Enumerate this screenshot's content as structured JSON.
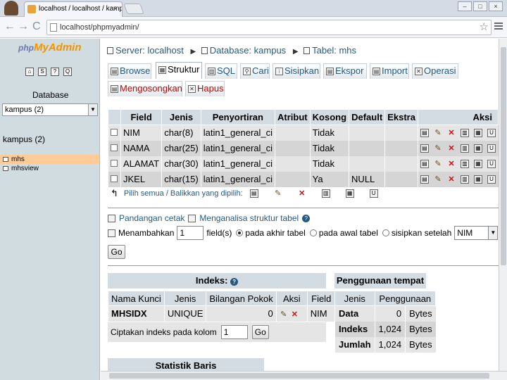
{
  "browser": {
    "tab_title": "localhost / localhost / kampus",
    "tab_close": "×",
    "url": "localhost/phpmyadmin/",
    "back": "←",
    "forward": "→",
    "reload": "C",
    "star": "☆",
    "win_min": "–",
    "win_max": "□",
    "win_close": "×"
  },
  "left": {
    "logo_php": "php",
    "logo_ma": "MyAdmin",
    "database_label": "Database",
    "db_select_value": "kampus (2)",
    "db_name": "kampus (2)",
    "tables": [
      "mhs",
      "mhsview"
    ]
  },
  "breadcrumb": {
    "server": "Server: localhost",
    "database": "Database: kampus",
    "table": "Tabel: mhs"
  },
  "tabs": [
    {
      "label": "Browse",
      "icon": "browse-icon"
    },
    {
      "label": "Struktur",
      "icon": "structure-icon"
    },
    {
      "label": "SQL",
      "icon": "sql-icon"
    },
    {
      "label": "Cari",
      "icon": "search-icon"
    },
    {
      "label": "Sisipkan",
      "icon": "insert-icon"
    },
    {
      "label": "Ekspor",
      "icon": "export-icon"
    },
    {
      "label": "Import",
      "icon": "import-icon"
    },
    {
      "label": "Operasi",
      "icon": "operations-icon"
    },
    {
      "label": "Mengosongkan",
      "icon": "empty-icon"
    },
    {
      "label": "Hapus",
      "icon": "drop-icon"
    }
  ],
  "structure": {
    "headers": [
      "Field",
      "Jenis",
      "Penyortiran",
      "Atribut",
      "Kosong",
      "Default",
      "Ekstra",
      "Aksi"
    ],
    "rows": [
      {
        "field": "NIM",
        "jenis": "char(8)",
        "collation": "latin1_general_ci",
        "atribut": "",
        "kosong": "Tidak",
        "default": "",
        "ekstra": ""
      },
      {
        "field": "NAMA",
        "jenis": "char(25)",
        "collation": "latin1_general_ci",
        "atribut": "",
        "kosong": "Tidak",
        "default": "",
        "ekstra": ""
      },
      {
        "field": "ALAMAT",
        "jenis": "char(30)",
        "collation": "latin1_general_ci",
        "atribut": "",
        "kosong": "Tidak",
        "default": "",
        "ekstra": ""
      },
      {
        "field": "JKEL",
        "jenis": "char(15)",
        "collation": "latin1_general_ci",
        "atribut": "",
        "kosong": "Ya",
        "default": "NULL",
        "ekstra": ""
      }
    ],
    "select_all": "Pilih semua / Balikkan yang dipilih:"
  },
  "links": {
    "print_view": "Pandangan cetak",
    "analyze": "Menganalisa struktur tabel"
  },
  "add_fields": {
    "label": "Menambahkan",
    "count": "1",
    "fields_label": "field(s)",
    "opt_end": "pada akhir tabel",
    "opt_begin": "pada awal tabel",
    "opt_after": "sisipkan setelah",
    "after_select": "NIM",
    "go": "Go"
  },
  "indexes": {
    "title": "Indeks:",
    "headers": [
      "Nama Kunci",
      "Jenis",
      "Bilangan Pokok",
      "Aksi",
      "Field"
    ],
    "row": {
      "name": "MHSIDX",
      "type": "UNIQUE",
      "cardinality": "0",
      "field": "NIM"
    },
    "create_label": "Ciptakan indeks pada kolom",
    "create_count": "1",
    "go": "Go"
  },
  "usage": {
    "title": "Penggunaan tempat",
    "headers": [
      "Jenis",
      "Penggunaan"
    ],
    "rows": [
      {
        "type": "Data",
        "value": "0",
        "unit": "Bytes"
      },
      {
        "type": "Indeks",
        "value": "1,024",
        "unit": "Bytes"
      },
      {
        "type": "Jumlah",
        "value": "1,024",
        "unit": "Bytes"
      }
    ]
  },
  "stats": {
    "title": "Statistik Baris"
  }
}
